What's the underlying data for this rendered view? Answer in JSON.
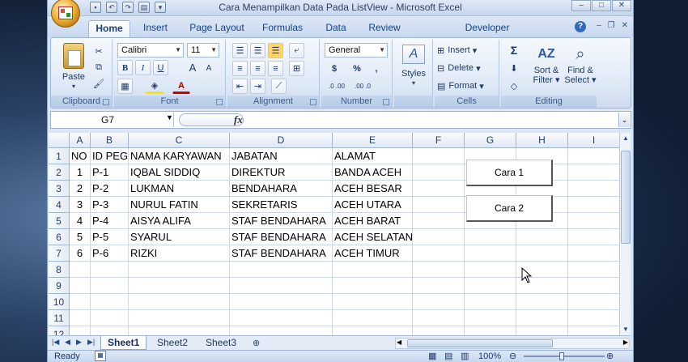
{
  "window": {
    "title": "Cara Menampilkan Data Pada ListView - Microsoft Excel"
  },
  "tabs": [
    "Home",
    "Insert",
    "Page Layout",
    "Formulas",
    "Data",
    "Review",
    "Developer"
  ],
  "ribbon": {
    "clipboard": {
      "label": "Clipboard",
      "paste": "Paste"
    },
    "font": {
      "label": "Font",
      "name": "Calibri",
      "size": "11",
      "bold": "B",
      "italic": "I",
      "underline": "U",
      "grow": "A",
      "shrink": "A",
      "font_color": "A"
    },
    "alignment": {
      "label": "Alignment"
    },
    "number": {
      "label": "Number",
      "format": "General",
      "currency": "$",
      "percent": "%",
      "comma": ",",
      "inc": ".0 .00",
      "dec": ".00 .0"
    },
    "styles": {
      "label": "Styles"
    },
    "cells": {
      "label": "Cells",
      "insert": "Insert",
      "delete": "Delete",
      "format": "Format"
    },
    "editing": {
      "label": "Editing",
      "sum": "Σ",
      "sort": "Sort &",
      "sort2": "Filter",
      "find": "Find &",
      "find2": "Select"
    }
  },
  "formula_bar": {
    "name_box": "G7",
    "fx": "fx",
    "value": ""
  },
  "columns": [
    "A",
    "B",
    "C",
    "D",
    "E",
    "F",
    "G",
    "H",
    "I"
  ],
  "rows": [
    "1",
    "2",
    "3",
    "4",
    "5",
    "6",
    "7",
    "8",
    "9",
    "10",
    "11",
    "12"
  ],
  "cells": [
    [
      "NO",
      "ID PEG",
      "NAMA KARYAWAN",
      "JABATAN",
      "ALAMAT"
    ],
    [
      "1",
      "P-1",
      "IQBAL SIDDIQ",
      "DIREKTUR",
      "BANDA ACEH"
    ],
    [
      "2",
      "P-2",
      "LUKMAN",
      "BENDAHARA",
      "ACEH BESAR"
    ],
    [
      "3",
      "P-3",
      "NURUL FATIN",
      "SEKRETARIS",
      "ACEH UTARA"
    ],
    [
      "4",
      "P-4",
      "AISYA ALIFA",
      "STAF BENDAHARA",
      "ACEH BARAT"
    ],
    [
      "5",
      "P-5",
      "SYARUL",
      "STAF BENDAHARA",
      "ACEH SELATAN"
    ],
    [
      "6",
      "P-6",
      "RIZKI",
      "STAF BENDAHARA",
      "ACEH TIMUR"
    ]
  ],
  "buttons": {
    "cara1": "Cara 1",
    "cara2": "Cara 2"
  },
  "sheets": [
    "Sheet1",
    "Sheet2",
    "Sheet3"
  ],
  "status": {
    "mode": "Ready",
    "zoom": "100%"
  }
}
